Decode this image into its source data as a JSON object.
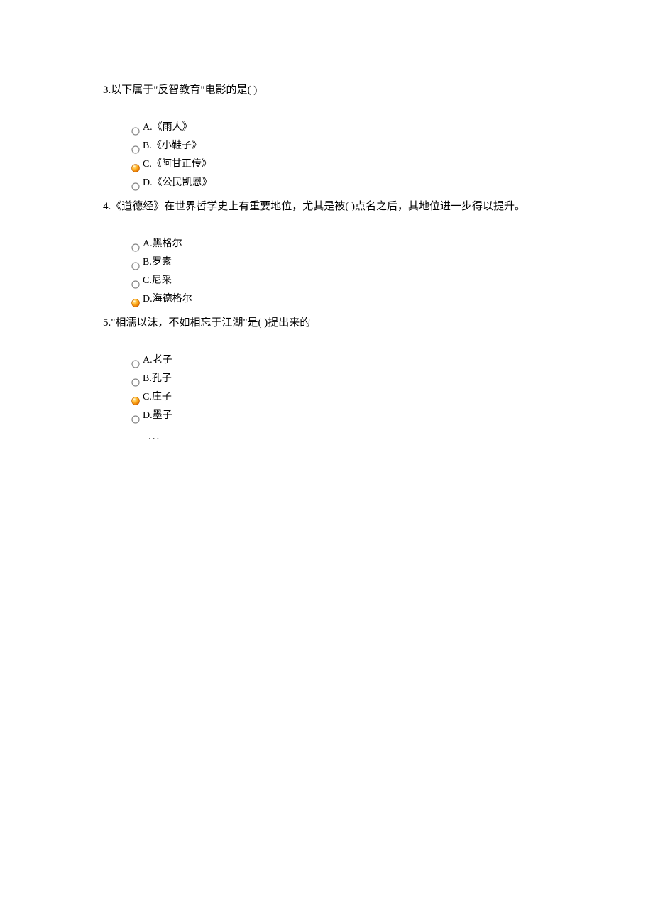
{
  "questions": [
    {
      "number": "3.",
      "text": "以下属于\"反智教育\"电影的是(   )",
      "options": [
        {
          "letter": "A.",
          "label": "《雨人》",
          "selected": false
        },
        {
          "letter": "B.",
          "label": "《小鞋子》",
          "selected": false
        },
        {
          "letter": "C.",
          "label": "《阿甘正传》",
          "selected": true
        },
        {
          "letter": "D.",
          "label": "《公民凯恩》",
          "selected": false
        }
      ]
    },
    {
      "number": "4.",
      "text": "《道德经》在世界哲学史上有重要地位，尤其是被(   )点名之后，其地位进一步得以提升。",
      "options": [
        {
          "letter": "A.",
          "label": "黑格尔",
          "selected": false
        },
        {
          "letter": "B.",
          "label": "罗素",
          "selected": false
        },
        {
          "letter": "C.",
          "label": "尼采",
          "selected": false
        },
        {
          "letter": "D.",
          "label": "海德格尔",
          "selected": true
        }
      ]
    },
    {
      "number": "5.",
      "text": "\"相濡以沫，不如相忘于江湖\"是(   )提出来的",
      "options": [
        {
          "letter": "A.",
          "label": "老子",
          "selected": false
        },
        {
          "letter": "B.",
          "label": "孔子",
          "selected": false
        },
        {
          "letter": "C.",
          "label": "庄子",
          "selected": true
        },
        {
          "letter": "D.",
          "label": "墨子",
          "selected": false
        }
      ]
    }
  ],
  "ellipsis": "..."
}
